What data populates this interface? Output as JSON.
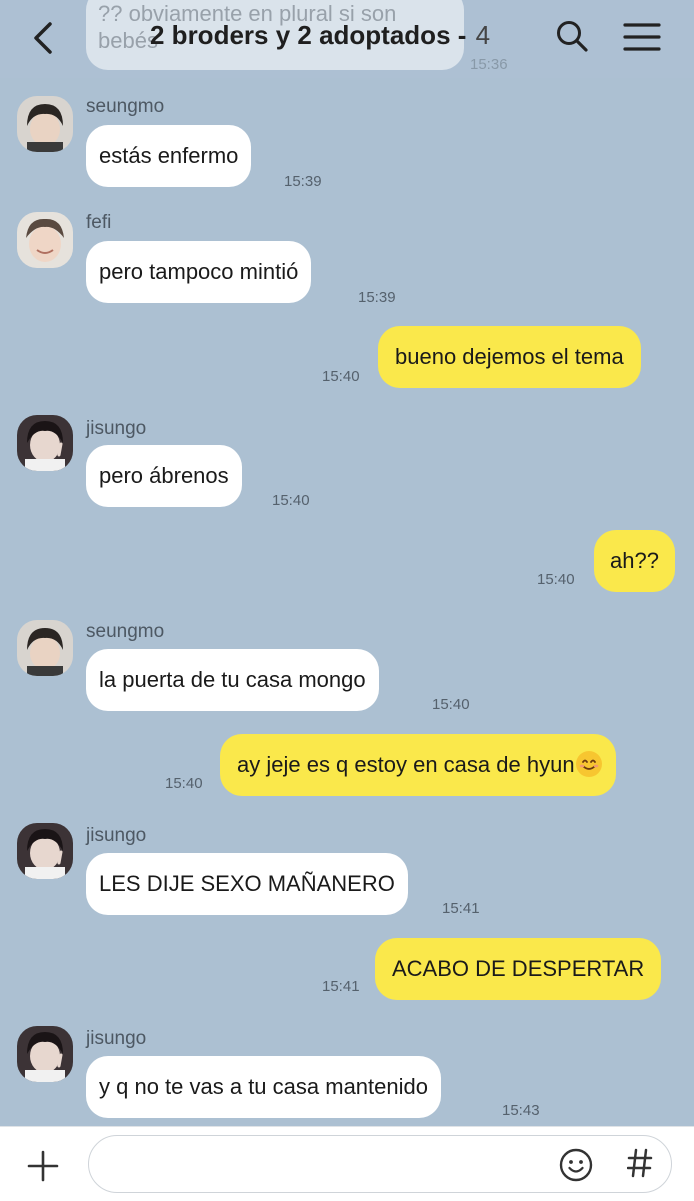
{
  "header": {
    "title": "2 broders y 2 adoptados -",
    "member_count": "4",
    "previous_message_text": "?? obviamente en plural si son bebés",
    "previous_message_time": "15:36"
  },
  "messages": [
    {
      "sender": "seungmo",
      "text": "estás enfermo",
      "time": "15:39"
    },
    {
      "sender": "fefi",
      "text": "pero tampoco mintió",
      "time": "15:39"
    },
    {
      "text": "bueno dejemos el tema",
      "time": "15:40"
    },
    {
      "sender": "jisungo",
      "text": "pero ábrenos",
      "time": "15:40"
    },
    {
      "text": "ah??",
      "time": "15:40"
    },
    {
      "sender": "seungmo",
      "text": "la puerta de tu casa mongo",
      "time": "15:40"
    },
    {
      "text": "ay jeje es q estoy en casa de hyun",
      "emoji": "smiling-face",
      "time": "15:40"
    },
    {
      "sender": "jisungo",
      "text": "LES DIJE SEXO MAÑANERO",
      "time": "15:41"
    },
    {
      "text": "ACABO DE DESPERTAR",
      "time": "15:41"
    },
    {
      "sender": "jisungo",
      "text": "y q no te vas a tu casa mantenido",
      "time": "15:43"
    }
  ],
  "input": {
    "value": "",
    "placeholder": ""
  },
  "icons": {
    "back": "chevron-left-icon",
    "search": "search-icon",
    "menu": "hamburger-menu-icon",
    "plus": "plus-icon",
    "emoji": "emoji-icon",
    "hashtag": "hashtag-icon"
  },
  "colors": {
    "background": "#acc0d2",
    "incoming_bubble": "#ffffff",
    "outgoing_bubble": "#fae84b"
  }
}
